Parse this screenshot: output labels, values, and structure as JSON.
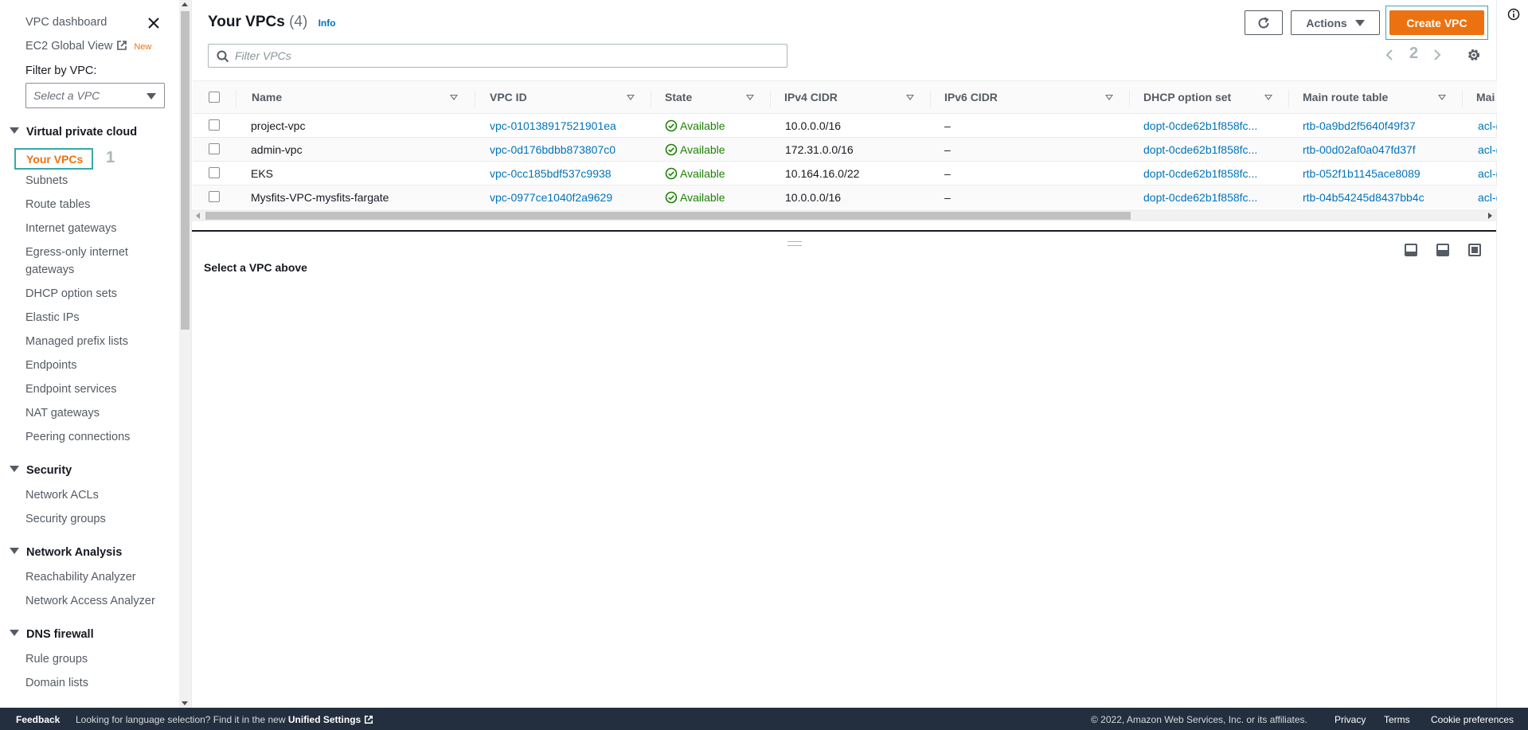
{
  "sidebar": {
    "dashboard": "VPC dashboard",
    "ec2_global_view": "EC2 Global View",
    "new_badge": "New",
    "filter_label": "Filter by VPC:",
    "filter_placeholder": "Select a VPC",
    "sections": [
      {
        "label": "Virtual private cloud"
      },
      {
        "label": "Security"
      },
      {
        "label": "Network Analysis"
      },
      {
        "label": "DNS firewall"
      }
    ],
    "vpc_items": [
      "Your VPCs",
      "Subnets",
      "Route tables",
      "Internet gateways",
      "Egress-only internet",
      "gateways",
      "DHCP option sets",
      "Elastic IPs",
      "Managed prefix lists",
      "Endpoints",
      "Endpoint services",
      "NAT gateways",
      "Peering connections"
    ],
    "security_items": [
      "Network ACLs",
      "Security groups"
    ],
    "analysis_items": [
      "Reachability Analyzer",
      "Network Access Analyzer"
    ],
    "dns_items": [
      "Rule groups",
      "Domain lists"
    ],
    "step_label": "1"
  },
  "header": {
    "title": "Your VPCs",
    "count": "(4)",
    "info": "Info",
    "actions_label": "Actions",
    "create_label": "Create VPC",
    "search_placeholder": "Filter VPCs",
    "page_step": "2"
  },
  "table": {
    "columns": [
      "Name",
      "VPC ID",
      "State",
      "IPv4 CIDR",
      "IPv6 CIDR",
      "DHCP option set",
      "Main route table",
      "Mai"
    ],
    "rows": [
      {
        "name": "project-vpc",
        "vpc_id": "vpc-010138917521901ea",
        "state": "Available",
        "ipv4": "10.0.0.0/16",
        "ipv6": "–",
        "dhcp": "dopt-0cde62b1f858fc...",
        "route": "rtb-0a9bd2f5640f49f37",
        "acl": "acl-("
      },
      {
        "name": "admin-vpc",
        "vpc_id": "vpc-0d176bdbb873807c0",
        "state": "Available",
        "ipv4": "172.31.0.0/16",
        "ipv6": "–",
        "dhcp": "dopt-0cde62b1f858fc...",
        "route": "rtb-00d02af0a047fd37f",
        "acl": "acl-("
      },
      {
        "name": "EKS",
        "vpc_id": "vpc-0cc185bdf537c9938",
        "state": "Available",
        "ipv4": "10.164.16.0/22",
        "ipv6": "–",
        "dhcp": "dopt-0cde62b1f858fc...",
        "route": "rtb-052f1b1145ace8089",
        "acl": "acl-("
      },
      {
        "name": "Mysfits-VPC-mysfits-fargate",
        "vpc_id": "vpc-0977ce1040f2a9629",
        "state": "Available",
        "ipv4": "10.0.0.0/16",
        "ipv6": "–",
        "dhcp": "dopt-0cde62b1f858fc...",
        "route": "rtb-04b54245d8437bb4c",
        "acl": "acl-("
      }
    ]
  },
  "split_panel": {
    "message": "Select a VPC above"
  },
  "footer": {
    "feedback": "Feedback",
    "lang_text": "Looking for language selection? Find it in the new",
    "unified_settings": "Unified Settings",
    "copyright": "© 2022, Amazon Web Services, Inc. or its affiliates.",
    "privacy": "Privacy",
    "terms": "Terms",
    "cookie": "Cookie preferences"
  },
  "colors": {
    "accent": "#ec7211",
    "link": "#0073bb",
    "success": "#1d8102",
    "footer_bg": "#232f3e",
    "highlight_box": "#38a8a8"
  },
  "icons": [
    "close-icon",
    "external-link-icon",
    "refresh-icon",
    "search-icon",
    "chevron-left-icon",
    "chevron-right-icon",
    "gear-icon",
    "check-circle-icon",
    "info-icon"
  ]
}
